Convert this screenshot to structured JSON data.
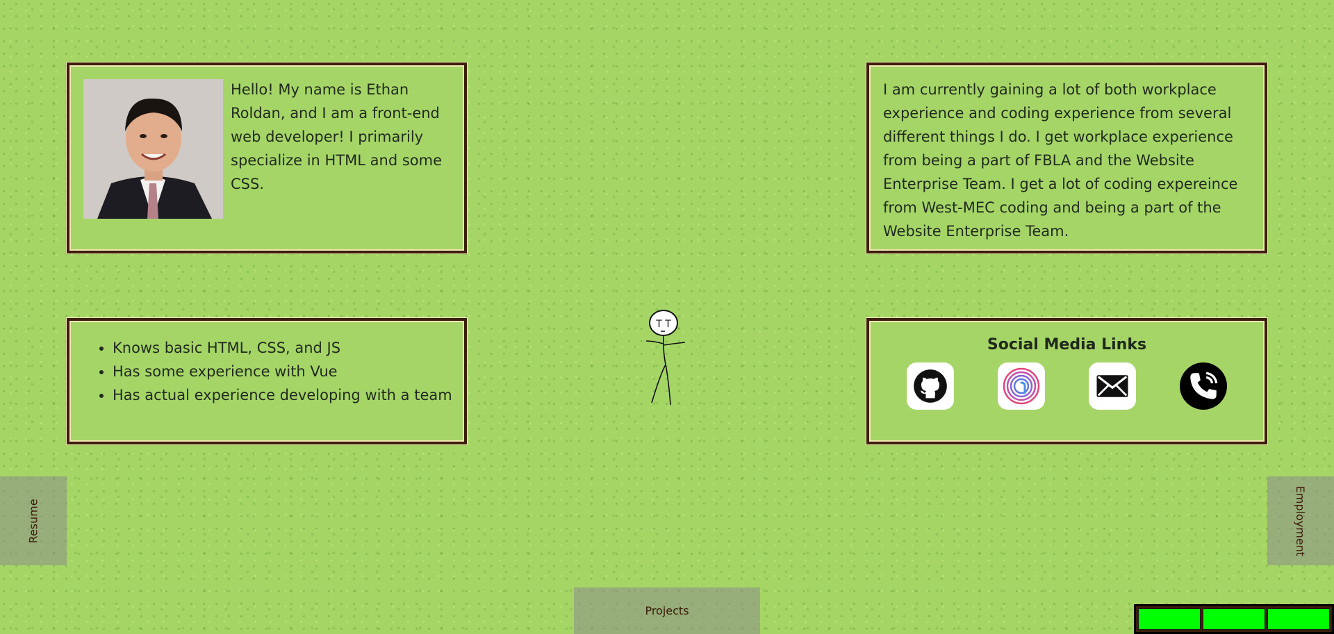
{
  "about": {
    "text": "Hello! My name is Ethan Roldan, and I am a front-end web developer! I primarily specialize in HTML and some CSS."
  },
  "experience": {
    "text": "I am currently gaining a lot of both workplace experience and coding experience from several different things I do. I get workplace experience from being a part of FBLA and the Website Enterprise Team. I get a lot of coding expereince from West-MEC coding and being a part of the Website Enterprise Team."
  },
  "skills": {
    "items": [
      "Knows basic HTML, CSS, and JS",
      "Has some experience with Vue",
      "Has actual experience developing with a team"
    ]
  },
  "social": {
    "title": "Social Media Links",
    "links": [
      {
        "icon": "github-icon"
      },
      {
        "icon": "fingerprint-icon"
      },
      {
        "icon": "mail-icon"
      },
      {
        "icon": "phone-icon"
      }
    ]
  },
  "nav": {
    "resume": "Resume",
    "employment": "Employment",
    "projects": "Projects"
  },
  "health": {
    "segments": 3,
    "color": "#00ff00"
  },
  "colors": {
    "background": "#a5d665",
    "panel_border": "#3b1f0a",
    "panel_fill": "#a6d567"
  }
}
